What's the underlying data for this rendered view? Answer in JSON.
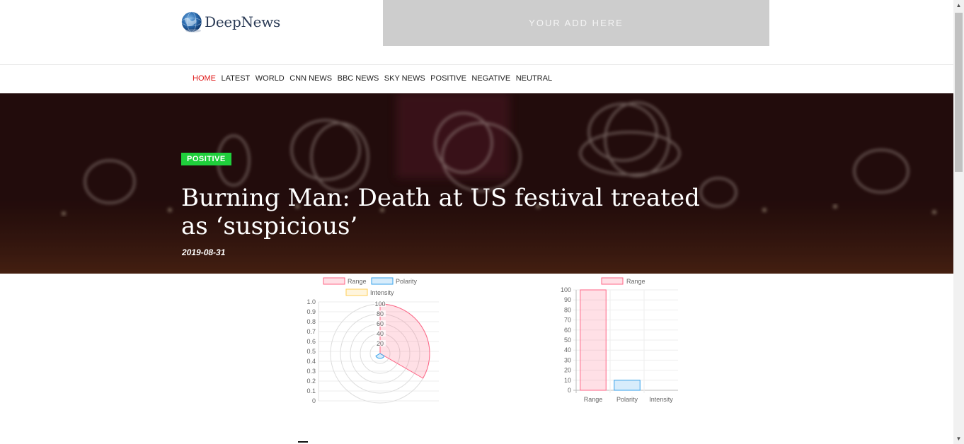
{
  "brand": {
    "name": "DeepNews"
  },
  "ad": {
    "text": "YOUR ADD HERE"
  },
  "nav": {
    "items": [
      {
        "label": "HOME",
        "active": true
      },
      {
        "label": "LATEST"
      },
      {
        "label": "WORLD"
      },
      {
        "label": "CNN NEWS"
      },
      {
        "label": "BBC NEWS"
      },
      {
        "label": "SKY NEWS"
      },
      {
        "label": "POSITIVE"
      },
      {
        "label": "NEGATIVE"
      },
      {
        "label": "NEUTRAL"
      }
    ]
  },
  "article": {
    "badge": "POSITIVE",
    "title": "Burning Man: Death at US festival treated as ‘suspicious’",
    "date": "2019-08-31"
  },
  "colors": {
    "accent_red": "#e01a1a",
    "badge_green": "#1fcf3c",
    "range": "#ff6384",
    "polarity": "#36a2eb",
    "intensity": "#ffce56"
  },
  "chart_data": [
    {
      "type": "polar",
      "legend": [
        "Range",
        "Polarity",
        "Intensity"
      ],
      "categories": [
        "Range",
        "Polarity",
        "Intensity"
      ],
      "values": [
        100,
        10,
        0
      ],
      "radial_ticks": [
        0,
        20,
        40,
        60,
        80,
        100
      ],
      "left_axis_ticks": [
        "0",
        "0.1",
        "0.2",
        "0.3",
        "0.4",
        "0.5",
        "0.6",
        "0.7",
        "0.8",
        "0.9",
        "1.0"
      ],
      "legend_position": "top"
    },
    {
      "type": "bar",
      "legend": [
        "Range"
      ],
      "categories": [
        "Range",
        "Polarity",
        "Intensity"
      ],
      "values": [
        100,
        10,
        0
      ],
      "ylim": [
        0,
        100
      ],
      "yticks": [
        0,
        10,
        20,
        30,
        40,
        50,
        60,
        70,
        80,
        90,
        100
      ],
      "legend_position": "top"
    }
  ]
}
